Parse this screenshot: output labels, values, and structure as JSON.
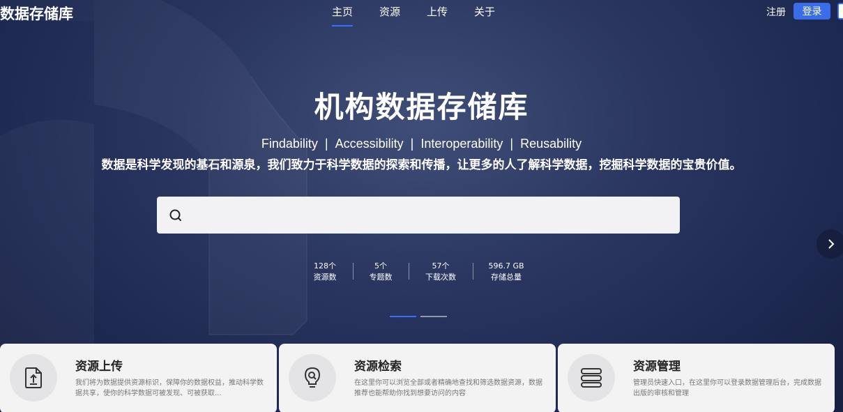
{
  "header": {
    "logo": "数据存储库",
    "nav": [
      "主页",
      "资源",
      "上传",
      "关于"
    ],
    "register": "注册",
    "login": "登录"
  },
  "hero": {
    "title": "机构数据存储库",
    "fair": [
      "Findability",
      "Accessibility",
      "Interoperability",
      "Reusability"
    ],
    "fair_separator": "|",
    "slogan": "数据是科学发现的基石和源泉，我们致力于科学数据的探索和传播，让更多的人了解科学数据，挖掘科学数据的宝贵价值。",
    "search_value": ""
  },
  "stats": [
    {
      "value": "128个",
      "label": "资源数"
    },
    {
      "value": "5个",
      "label": "专题数"
    },
    {
      "value": "57个",
      "label": "下载次数"
    },
    {
      "value": "596.7 GB",
      "label": "存储总量"
    }
  ],
  "carousel": {
    "slide_count": 2,
    "active_index": 0
  },
  "cards": [
    {
      "title": "资源上传",
      "description": "我们将为数据提供资源标识，保障你的数据权益，推动科学数据共享，使你的科学数据可被发现、可被获取...",
      "icon": "upload-file-icon"
    },
    {
      "title": "资源检索",
      "description": "在这里你可以浏览全部或者精确地查找和筛选数据资源，数据推荐也能帮助你找到想要访问的内容",
      "icon": "search-bulb-icon"
    },
    {
      "title": "资源管理",
      "description": "管理员快速入口，在这里你可以登录数据管理后台，完成数据出版的审核和管理",
      "icon": "server-stack-icon"
    }
  ],
  "colors": {
    "accent": "#3a6ee8",
    "background": "#1d2850",
    "card_bg": "#f3f3f4"
  }
}
